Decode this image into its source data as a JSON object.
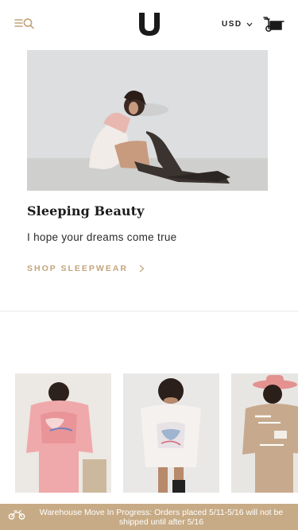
{
  "header": {
    "menu_icon": "menu-search-icon",
    "logo_icon": "brand-logo-u",
    "currency_label": "USD",
    "cart_icon": "motorcycle-cart-icon"
  },
  "feature": {
    "title": "Sleeping Beauty",
    "subtitle": "I hope your dreams come true",
    "cta_label": "SHOP SLEEPWEAR"
  },
  "products": [
    {
      "name": "pink-graphic-pajama-set"
    },
    {
      "name": "white-graphic-shirt"
    },
    {
      "name": "tan-graphic-pajama-set"
    }
  ],
  "announcement": {
    "icon": "motorcycle-icon",
    "text": "Warehouse Move In Progress: Orders placed 5/11-5/16 will not be shipped until after 5/16"
  },
  "colors": {
    "accent": "#c2a47a",
    "announcement_bg": "#c7ab86",
    "text": "#1f1f1f"
  }
}
